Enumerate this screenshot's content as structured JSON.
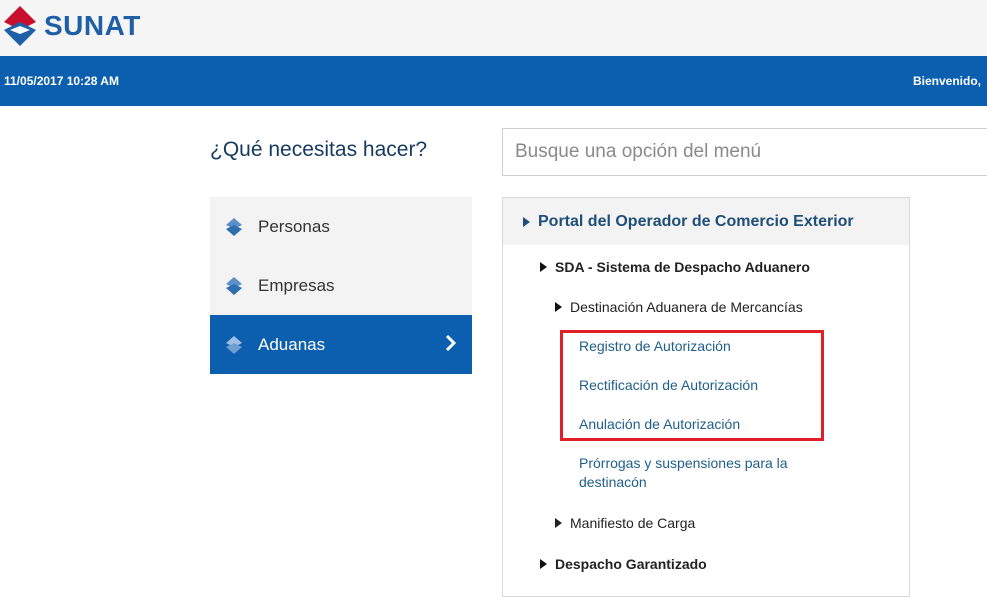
{
  "header": {
    "logo_text": "SUNAT",
    "datetime": "11/05/2017 10:28 AM",
    "welcome": "Bienvenido,"
  },
  "main": {
    "question": "¿Qué necesitas hacer?",
    "search": {
      "placeholder": "Busque una opción del menú",
      "value": ""
    }
  },
  "categories": [
    {
      "label": "Personas",
      "icon": "sunat-diamond-icon"
    },
    {
      "label": "Empresas",
      "icon": "sunat-diamond-icon"
    },
    {
      "label": "Aduanas",
      "icon": "sunat-diamond-icon",
      "active": true
    }
  ],
  "menu": {
    "title": "Portal del Operador de Comercio Exterior",
    "section": "SDA - Sistema de Despacho Aduanero",
    "subsection": "Destinación Aduanera de Mercancías",
    "links": [
      "Registro de Autorización",
      "Rectificación de Autorización",
      "Anulación de Autorización",
      "Prórrogas y suspensiones para la destinacón"
    ],
    "subsection2": "Manifiesto de Carga",
    "section2": "Despacho Garantizado"
  },
  "colors": {
    "brand_blue": "#0b5fae",
    "brand_red": "#c8102e",
    "highlight_red": "#e01f26"
  }
}
